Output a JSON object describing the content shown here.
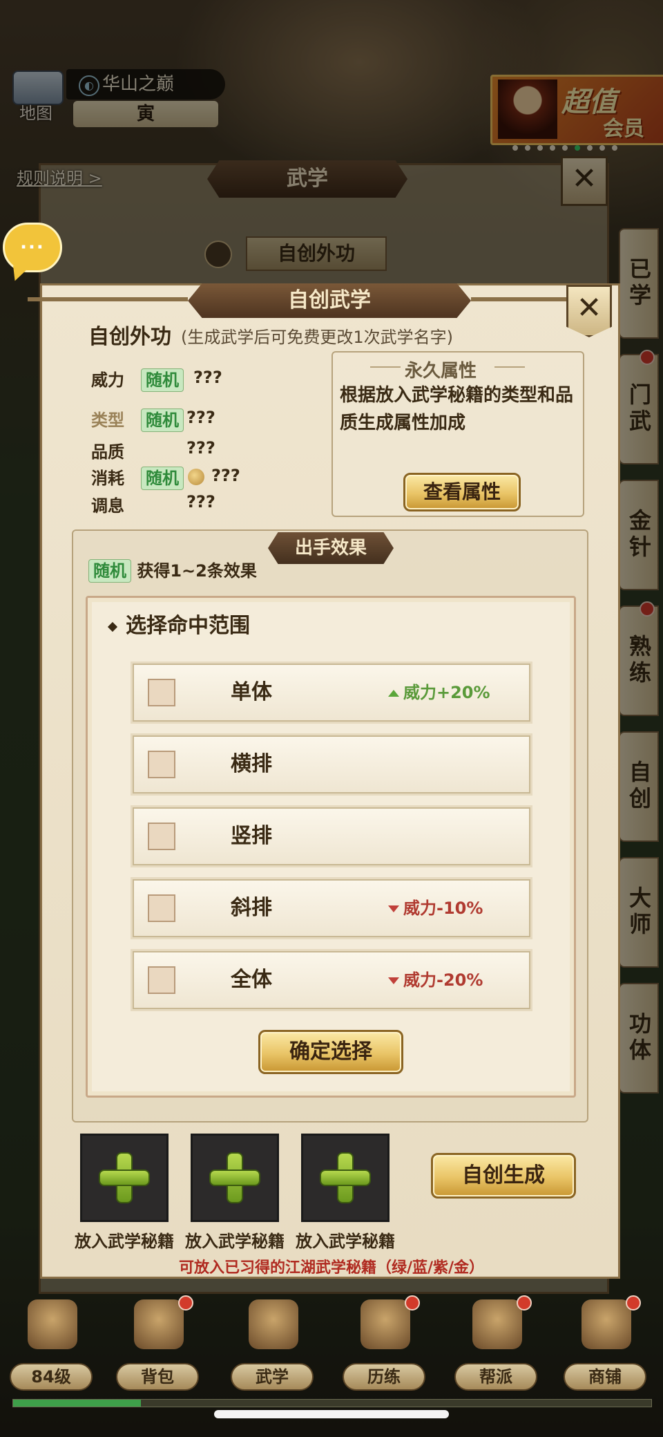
{
  "hud": {
    "map_label": "地图",
    "location": "华山之巅",
    "time": "寅",
    "vip_line1": "超值",
    "vip_line2": "会员",
    "rules_link": "规则说明 >",
    "chat_dots": "···"
  },
  "side_nav": [
    "已学",
    "门武",
    "金针",
    "熟练",
    "自创",
    "大师",
    "功体"
  ],
  "underlay": {
    "title": "武学",
    "tab": "自创外功",
    "close": "✕"
  },
  "modal": {
    "title": "自创武学",
    "close": "✕",
    "skill_name": "自创外功",
    "skill_note": "(生成武学后可免费更改1次武学名字)",
    "stats": {
      "power": {
        "label": "威力",
        "tag": "随机",
        "value": "???"
      },
      "type": {
        "label": "类型",
        "tag": "随机",
        "value": "???"
      },
      "quality": {
        "label": "品质",
        "value": "???"
      },
      "cost": {
        "label": "消耗",
        "tag": "随机",
        "value": "???"
      },
      "regen": {
        "label": "调息",
        "value": "???"
      }
    },
    "permanent": {
      "title": "永久属性",
      "text": "根据放入武学秘籍的类型和品质生成属性加成",
      "button": "查看属性"
    },
    "effects": {
      "title": "出手效果",
      "tag": "随机",
      "text": "获得1~2条效果"
    },
    "range": {
      "title": "选择命中范围",
      "options": [
        {
          "name": "单体",
          "effect": "威力+20%",
          "dir": "up"
        },
        {
          "name": "横排",
          "effect": "",
          "dir": ""
        },
        {
          "name": "竖排",
          "effect": "",
          "dir": ""
        },
        {
          "name": "斜排",
          "effect": "威力-10%",
          "dir": "down"
        },
        {
          "name": "全体",
          "effect": "威力-20%",
          "dir": "down"
        }
      ],
      "confirm": "确定选择"
    },
    "slots": [
      {
        "label": "放入武学秘籍"
      },
      {
        "label": "放入武学秘籍"
      },
      {
        "label": "放入武学秘籍"
      }
    ],
    "generate": "自创生成",
    "hint": "可放入已习得的江湖武学秘籍（绿/蓝/紫/金）"
  },
  "bottom_nav": [
    "84级",
    "背包",
    "武学",
    "历练",
    "帮派",
    "商铺"
  ],
  "colors": {
    "accent_green": "#2e8a3a",
    "accent_red": "#b02a20",
    "gold": "#e9c466"
  }
}
